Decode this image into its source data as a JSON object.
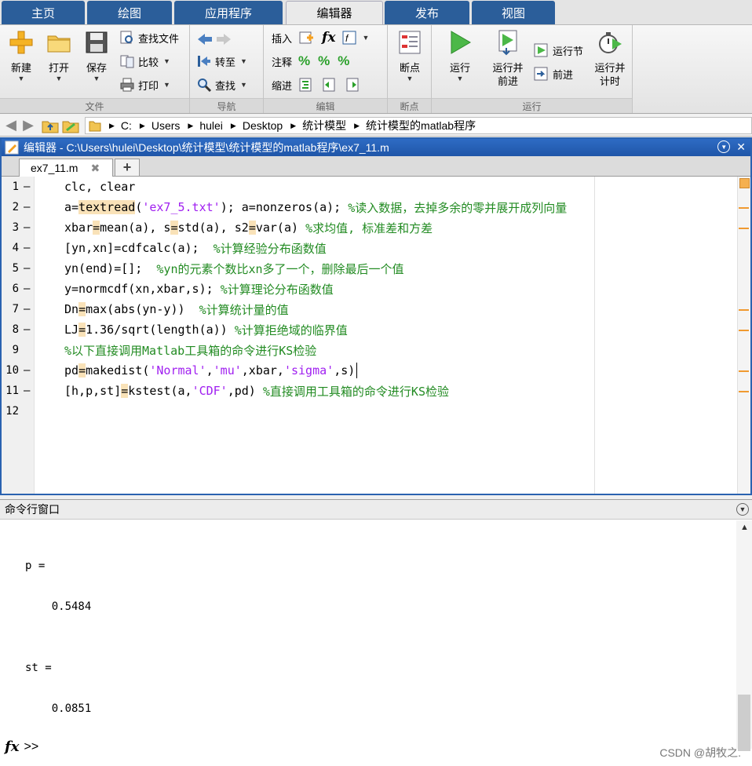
{
  "ribbon_tabs": [
    "主页",
    "绘图",
    "应用程序",
    "编辑器",
    "发布",
    "视图"
  ],
  "active_tab": "编辑器",
  "groups": {
    "file": {
      "label": "文件",
      "new": "新建",
      "open": "打开",
      "save": "保存",
      "find_files": "查找文件",
      "compare": "比较",
      "print": "打印"
    },
    "nav": {
      "label": "导航",
      "goto": "转至",
      "find": "查找"
    },
    "edit": {
      "label": "编辑",
      "insert": "插入",
      "comment": "注释",
      "indent": "缩进",
      "fx": "fx"
    },
    "breakpoints": {
      "label": "断点",
      "breakpoint": "断点"
    },
    "run": {
      "label": "运行",
      "run": "运行",
      "run_advance": "运行并前进",
      "run_section": "运行节",
      "advance": "前进",
      "run_time": "运行并计时"
    }
  },
  "breadcrumb": [
    "C:",
    "Users",
    "hulei",
    "Desktop",
    "统计模型",
    "统计模型的matlab程序"
  ],
  "editor": {
    "title": "编辑器 - C:\\Users\\hulei\\Desktop\\统计模型\\统计模型的matlab程序\\ex7_11.m",
    "file_tab": "ex7_11.m",
    "close_glyph": "✖",
    "add_tab": "+",
    "line_numbers": [
      "1",
      "2",
      "3",
      "4",
      "5",
      "6",
      "7",
      "8",
      "9",
      "10",
      "11",
      "12"
    ],
    "line_dashes": [
      "—",
      "—",
      "—",
      "—",
      "—",
      "—",
      "—",
      "—",
      "",
      "—",
      "—",
      ""
    ],
    "code": [
      [
        {
          "t": "clc, clear",
          "c": "kw"
        }
      ],
      [
        {
          "t": "a=",
          "c": "kw"
        },
        {
          "t": "textread",
          "c": "kw hl"
        },
        {
          "t": "(",
          "c": "kw"
        },
        {
          "t": "'ex7_5.txt'",
          "c": "str"
        },
        {
          "t": "); a=nonzeros(a); ",
          "c": "kw"
        },
        {
          "t": "%读入数据，去掉多余的零并展开成列向量",
          "c": "cmt"
        }
      ],
      [
        {
          "t": "xbar",
          "c": "kw"
        },
        {
          "t": "=",
          "c": "kw hl"
        },
        {
          "t": "mean(a), s",
          "c": "kw"
        },
        {
          "t": "=",
          "c": "kw hl"
        },
        {
          "t": "std(a), s2",
          "c": "kw"
        },
        {
          "t": "=",
          "c": "kw hl"
        },
        {
          "t": "var(a) ",
          "c": "kw"
        },
        {
          "t": "%求均值, 标准差和方差",
          "c": "cmt"
        }
      ],
      [
        {
          "t": "[yn,xn]=cdfcalc(a);  ",
          "c": "kw"
        },
        {
          "t": "%计算经验分布函数值",
          "c": "cmt"
        }
      ],
      [
        {
          "t": "yn(end)=[];  ",
          "c": "kw"
        },
        {
          "t": "%yn的元素个数比xn多了一个，删除最后一个值",
          "c": "cmt"
        }
      ],
      [
        {
          "t": "y=normcdf(xn,xbar,s); ",
          "c": "kw"
        },
        {
          "t": "%计算理论分布函数值",
          "c": "cmt"
        }
      ],
      [
        {
          "t": "Dn",
          "c": "kw"
        },
        {
          "t": "=",
          "c": "kw hl"
        },
        {
          "t": "max(abs(yn-y))  ",
          "c": "kw"
        },
        {
          "t": "%计算统计量的值",
          "c": "cmt"
        }
      ],
      [
        {
          "t": "LJ",
          "c": "kw"
        },
        {
          "t": "=",
          "c": "kw hl"
        },
        {
          "t": "1.36/sqrt(length(a)) ",
          "c": "kw"
        },
        {
          "t": "%计算拒绝域的临界值",
          "c": "cmt"
        }
      ],
      [
        {
          "t": "%以下直接调用Matlab工具箱的命令进行KS检验",
          "c": "cmt"
        }
      ],
      [
        {
          "t": "pd",
          "c": "kw"
        },
        {
          "t": "=",
          "c": "kw hl"
        },
        {
          "t": "makedist(",
          "c": "kw"
        },
        {
          "t": "'Normal'",
          "c": "str"
        },
        {
          "t": ",",
          "c": "kw"
        },
        {
          "t": "'mu'",
          "c": "str"
        },
        {
          "t": ",xbar,",
          "c": "kw"
        },
        {
          "t": "'sigma'",
          "c": "str"
        },
        {
          "t": ",s)",
          "c": "kw"
        }
      ],
      [
        {
          "t": "[h,p,st]",
          "c": "kw"
        },
        {
          "t": "=",
          "c": "kw hl"
        },
        {
          "t": "kstest(a,",
          "c": "kw"
        },
        {
          "t": "'CDF'",
          "c": "str"
        },
        {
          "t": ",pd) ",
          "c": "kw"
        },
        {
          "t": "%直接调用工具箱的命令进行KS检验",
          "c": "cmt"
        }
      ],
      []
    ]
  },
  "command_window": {
    "title": "命令行窗口",
    "output": [
      "p =",
      "    0.5484",
      "st =",
      "    0.0851"
    ],
    "fx_label": "fx",
    "prompt": ">>"
  },
  "watermark": "CSDN @胡牧之."
}
